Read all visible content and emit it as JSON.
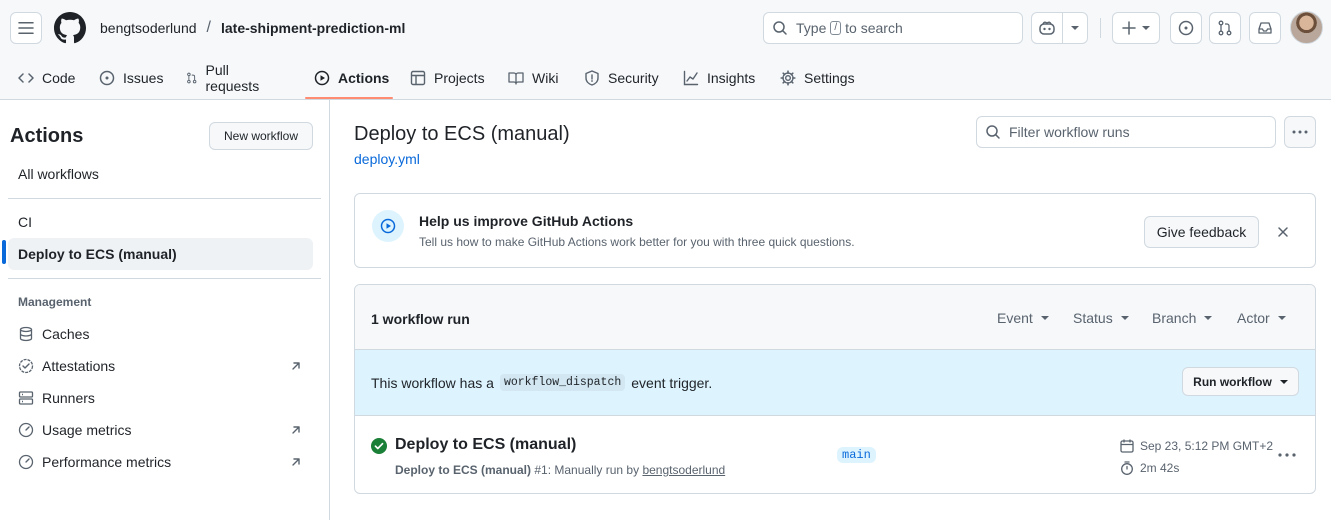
{
  "header": {
    "owner": "bengtsoderlund",
    "separator": "/",
    "repo": "late-shipment-prediction-ml",
    "search_type": "Type",
    "search_slash": "/",
    "search_rest": "to search"
  },
  "tabs": [
    {
      "label": "Code",
      "icon": "code-icon"
    },
    {
      "label": "Issues",
      "icon": "issue-opened-icon"
    },
    {
      "label": "Pull requests",
      "icon": "git-pull-request-icon"
    },
    {
      "label": "Actions",
      "icon": "play-icon",
      "active": true
    },
    {
      "label": "Projects",
      "icon": "table-icon"
    },
    {
      "label": "Wiki",
      "icon": "book-icon"
    },
    {
      "label": "Security",
      "icon": "shield-icon"
    },
    {
      "label": "Insights",
      "icon": "graph-icon"
    },
    {
      "label": "Settings",
      "icon": "gear-icon"
    }
  ],
  "sidebar": {
    "title": "Actions",
    "new_workflow": "New workflow",
    "all_workflows": "All workflows",
    "workflows": [
      "CI",
      "Deploy to ECS (manual)"
    ],
    "management_heading": "Management",
    "management": [
      {
        "label": "Caches",
        "icon": "database-icon",
        "external": false
      },
      {
        "label": "Attestations",
        "icon": "verified-icon",
        "external": true
      },
      {
        "label": "Runners",
        "icon": "server-icon",
        "external": false
      },
      {
        "label": "Usage metrics",
        "icon": "meter-icon",
        "external": true
      },
      {
        "label": "Performance metrics",
        "icon": "meter-icon",
        "external": true
      }
    ]
  },
  "main": {
    "title": "Deploy to ECS (manual)",
    "file": "deploy.yml",
    "filter_placeholder": "Filter workflow runs",
    "feedback": {
      "title": "Help us improve GitHub Actions",
      "subtitle": "Tell us how to make GitHub Actions work better for you with three quick questions.",
      "button": "Give feedback"
    },
    "runs": {
      "count": "1 workflow run",
      "filters": [
        "Event",
        "Status",
        "Branch",
        "Actor"
      ],
      "dispatch_pre": "This workflow has a",
      "dispatch_code": "workflow_dispatch",
      "dispatch_post": "event trigger.",
      "run_workflow": "Run workflow",
      "items": [
        {
          "title": "Deploy to ECS (manual)",
          "workflow": "Deploy to ECS (manual)",
          "run_info": "#1: Manually run by",
          "actor": "bengtsoderlund",
          "branch": "main",
          "date": "Sep 23, 5:12 PM GMT+2",
          "duration": "2m 42s",
          "status": "success"
        }
      ]
    }
  },
  "colors": {
    "accent": "#0969da",
    "success": "#1a7f37",
    "tab_underline": "#fd8c73",
    "info_bg": "#ddf4ff"
  }
}
